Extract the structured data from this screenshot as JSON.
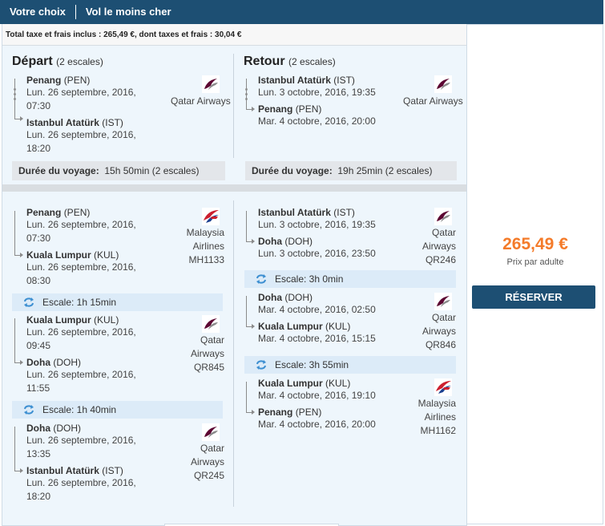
{
  "header": {
    "tabs": [
      "Votre choix",
      "Vol le moins cher"
    ]
  },
  "summary": "Total taxe et frais inclus : 265,49 €, dont taxes et frais : 30,04 €",
  "price": {
    "value": "265,49 €",
    "label": "Prix par adulte",
    "button": "RÉSERVER"
  },
  "colors": {
    "header": "#1d4f73",
    "price": "#f47b2a",
    "stop_bg": "#dcebf8",
    "panel_bg": "#eef6fc"
  },
  "icons": {
    "stopover": "refresh-arrows-icon",
    "qatar": "qatar-oryx-logo",
    "malaysia": "malaysia-kite-logo"
  },
  "depart": {
    "title": "Départ",
    "escales": "(2 escales)",
    "from_city": "Penang",
    "from_code": "(PEN)",
    "from_dt": "Lun. 26 septembre, 2016, 07:30",
    "to_city": "Istanbul Atatürk",
    "to_code": "(IST)",
    "to_dt": "Lun. 26 septembre, 2016, 18:20",
    "airline": "Qatar Airways",
    "duration_label": "Durée du voyage:",
    "duration_value": "15h 50min (2 escales)"
  },
  "retour": {
    "title": "Retour",
    "escales": "(2 escales)",
    "from_city": "Istanbul Atatürk",
    "from_code": "(IST)",
    "from_dt": "Lun. 3 octobre, 2016, 19:35",
    "to_city": "Penang",
    "to_code": "(PEN)",
    "to_dt": "Mar. 4 octobre, 2016, 20:00",
    "airline": "Qatar Airways",
    "duration_label": "Durée du voyage:",
    "duration_value": "19h 25min (2 escales)"
  },
  "left_segments": [
    {
      "from_city": "Penang",
      "from_code": "(PEN)",
      "from_dt": "Lun. 26 septembre, 2016, 07:30",
      "to_city": "Kuala Lumpur",
      "to_code": "(KUL)",
      "to_dt": "Lun. 26 septembre, 2016, 08:30",
      "airline": "Malaysia Airlines",
      "flight": "MH1133"
    },
    {
      "from_city": "Kuala Lumpur",
      "from_code": "(KUL)",
      "from_dt": "Lun. 26 septembre, 2016, 09:45",
      "to_city": "Doha",
      "to_code": "(DOH)",
      "to_dt": "Lun. 26 septembre, 2016, 11:55",
      "airline": "Qatar Airways",
      "flight": "QR845"
    },
    {
      "from_city": "Doha",
      "from_code": "(DOH)",
      "from_dt": "Lun. 26 septembre, 2016, 13:35",
      "to_city": "Istanbul Atatürk",
      "to_code": "(IST)",
      "to_dt": "Lun. 26 septembre, 2016, 18:20",
      "airline": "Qatar Airways",
      "flight": "QR245"
    }
  ],
  "left_stops": [
    "Escale: 1h 15min",
    "Escale: 1h 40min"
  ],
  "right_segments": [
    {
      "from_city": "Istanbul Atatürk",
      "from_code": "(IST)",
      "from_dt": "Lun. 3 octobre, 2016, 19:35",
      "to_city": "Doha",
      "to_code": "(DOH)",
      "to_dt": "Lun. 3 octobre, 2016, 23:50",
      "airline": "Qatar Airways",
      "flight": "QR246"
    },
    {
      "from_city": "Doha",
      "from_code": "(DOH)",
      "from_dt": "Mar. 4 octobre, 2016, 02:50",
      "to_city": "Kuala Lumpur",
      "to_code": "(KUL)",
      "to_dt": "Mar. 4 octobre, 2016, 15:15",
      "airline": "Qatar Airways",
      "flight": "QR846"
    },
    {
      "from_city": "Kuala Lumpur",
      "from_code": "(KUL)",
      "from_dt": "Mar. 4 octobre, 2016, 19:10",
      "to_city": "Penang",
      "to_code": "(PEN)",
      "to_dt": "Mar. 4 octobre, 2016, 20:00",
      "airline": "Malaysia Airlines",
      "flight": "MH1162"
    }
  ],
  "right_stops": [
    "Escale: 3h 0min",
    "Escale: 3h 55min"
  ]
}
